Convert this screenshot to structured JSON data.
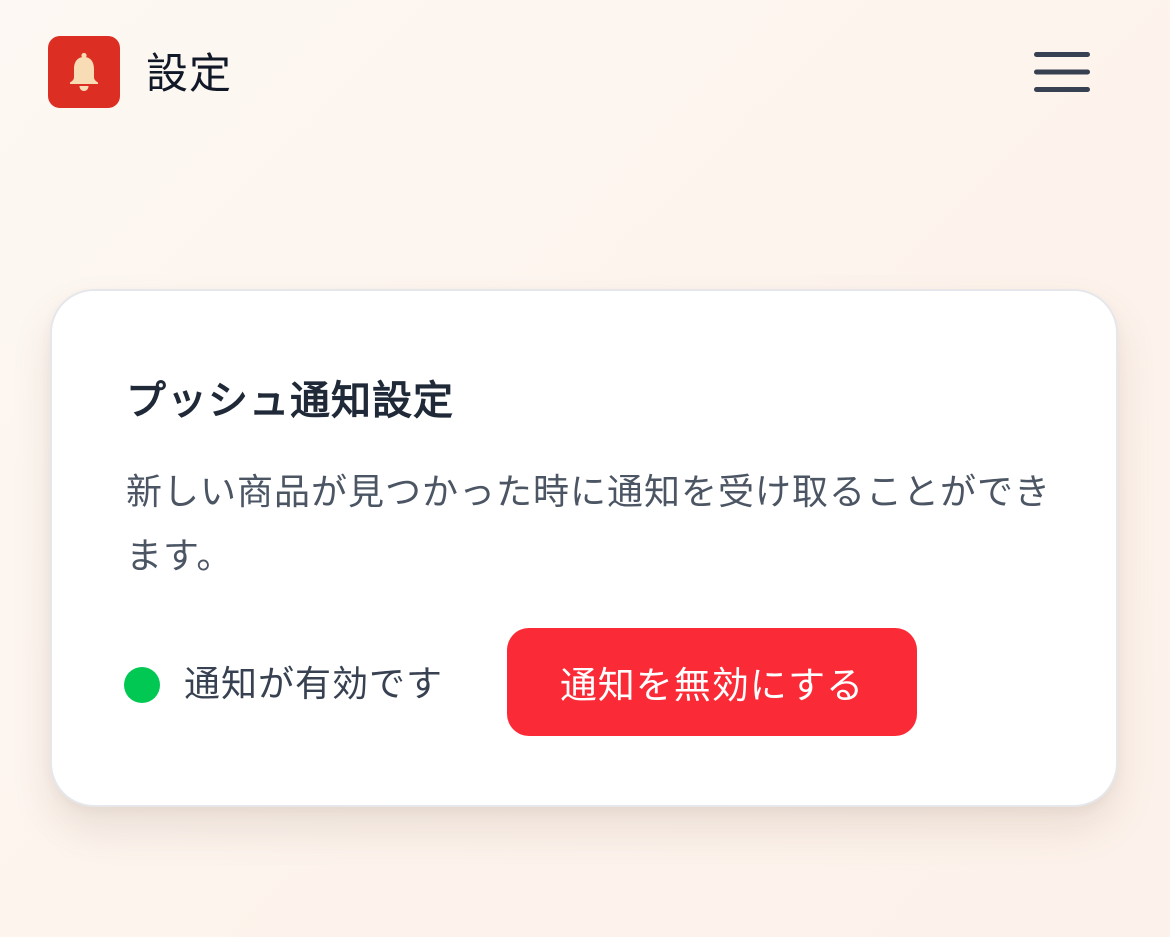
{
  "header": {
    "title": "設定",
    "app_icon": "bell-icon",
    "menu_icon": "hamburger-menu-icon"
  },
  "card": {
    "title": "プッシュ通知設定",
    "description": "新しい商品が見つかった時に通知を受け取ることができます。",
    "status_text": "通知が有効です",
    "status_color": "#00c853",
    "disable_button_label": "通知を無効にする",
    "button_color": "#fb2a37"
  },
  "colors": {
    "app_icon_bg": "#dc2e22",
    "bell": "#f7dcb6"
  }
}
